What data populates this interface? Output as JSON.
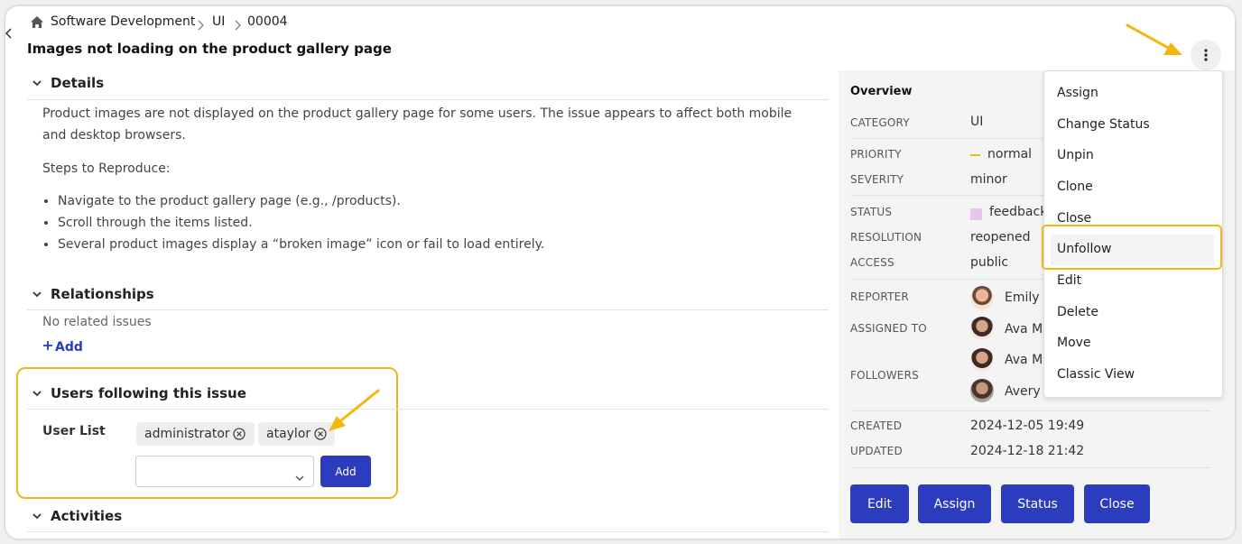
{
  "breadcrumb": {
    "project": "Software Development",
    "component": "UI",
    "issue_id": "00004"
  },
  "issue": {
    "title": "Images not loading on the product gallery page"
  },
  "details": {
    "heading": "Details",
    "description": "Product images are not displayed on the product gallery page for some users. The issue appears to affect both mobile and desktop browsers.",
    "steps_label": "Steps to Reproduce:",
    "steps": [
      "Navigate to the product gallery page (e.g., /products).",
      "Scroll through the items listed.",
      "Several product images display a “broken image” icon or fail to load entirely."
    ]
  },
  "relationships": {
    "heading": "Relationships",
    "empty_text": "No related issues",
    "add_label": "Add"
  },
  "followers_section": {
    "heading": "Users following this issue",
    "user_list_label": "User List",
    "users": [
      "administrator",
      "ataylor"
    ],
    "select_value": "",
    "add_button": "Add"
  },
  "activities": {
    "heading": "Activities"
  },
  "overview": {
    "heading": "Overview",
    "category_label": "CATEGORY",
    "category": "UI",
    "priority_label": "PRIORITY",
    "priority": "normal",
    "severity_label": "SEVERITY",
    "severity": "minor",
    "status_label": "STATUS",
    "status": "feedback",
    "resolution_label": "RESOLUTION",
    "resolution": "reopened",
    "access_label": "ACCESS",
    "access": "public",
    "reporter_label": "REPORTER",
    "reporter": "Emily",
    "assigned_label": "ASSIGNED TO",
    "assigned": "Ava M",
    "followers_label": "FOLLOWERS",
    "followers": [
      "Ava M",
      "Avery"
    ],
    "created_label": "CREATED",
    "created": "2024-12-05 19:49",
    "updated_label": "UPDATED",
    "updated": "2024-12-18 21:42"
  },
  "actions": {
    "edit": "Edit",
    "assign": "Assign",
    "status": "Status",
    "close": "Close"
  },
  "menu": {
    "items": [
      "Assign",
      "Change Status",
      "Unpin",
      "Clone",
      "Close",
      "Unfollow",
      "Edit",
      "Delete",
      "Move",
      "Classic View"
    ]
  },
  "colors": {
    "accent": "#2b3cbf",
    "highlight": "#f2b80f",
    "priority": "#f2b80f",
    "status_swatch": "#e7c6ea"
  },
  "icons": {
    "home": "home-icon",
    "back": "chevron-left-icon",
    "more": "vertical-dots-icon",
    "remove": "circle-x-icon",
    "plus": "plus-icon",
    "dropdown": "chevron-down-icon"
  }
}
